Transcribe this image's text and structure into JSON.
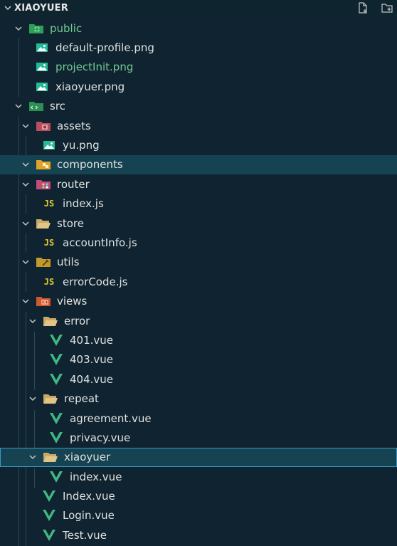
{
  "explorer": {
    "section_title": "XIAOYUER"
  },
  "tree": {
    "public": "public",
    "default_profile": "default-profile.png",
    "projectInit": "projectInit.png",
    "xiaoyuer_png": "xiaoyuer.png",
    "src": "src",
    "assets": "assets",
    "yu_png": "yu.png",
    "components": "components",
    "router": "router",
    "router_index": "index.js",
    "store": "store",
    "accountInfo": "accountInfo.js",
    "utils": "utils",
    "errorCode": "errorCode.js",
    "views": "views",
    "error": "error",
    "v401": "401.vue",
    "v403": "403.vue",
    "v404": "404.vue",
    "repeat": "repeat",
    "agreement": "agreement.vue",
    "privacy": "privacy.vue",
    "xiaoyuer_dir": "xiaoyuer",
    "xiaoyuer_index": "index.vue",
    "Index_vue": "Index.vue",
    "Login_vue": "Login.vue",
    "Test_vue": "Test.vue"
  },
  "icons": {
    "js_badge": "JS"
  },
  "colors": {
    "background": "#0f2430",
    "selected": "#154351",
    "git_added": "#73c991",
    "vue": "#41b883",
    "js": "#e3c62b",
    "focus_outline": "#3b98c4"
  }
}
